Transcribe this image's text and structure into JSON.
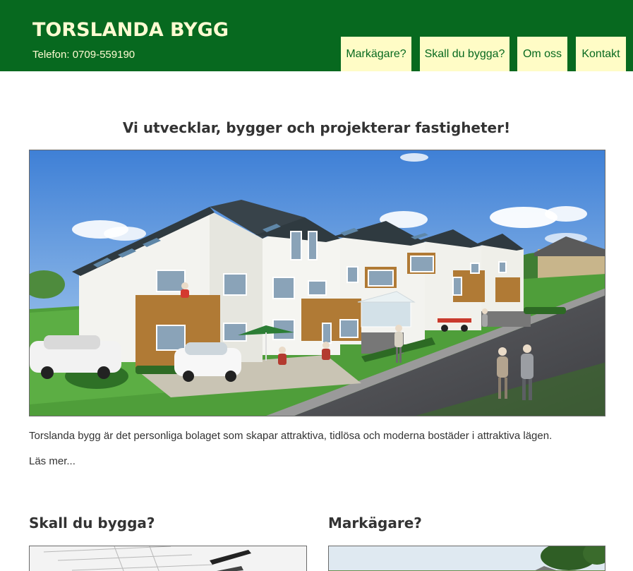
{
  "header": {
    "brand": "TORSLANDA BYGG",
    "phone": "Telefon: 0709-559190",
    "colors": {
      "background": "#07691f",
      "brand_text": "#fffbd2",
      "nav_background": "#fffcc6",
      "nav_text": "#07691f"
    }
  },
  "nav": {
    "items": [
      {
        "label": "Markägare?"
      },
      {
        "label": "Skall du bygga?"
      },
      {
        "label": "Om oss"
      },
      {
        "label": "Kontakt"
      }
    ]
  },
  "main": {
    "heading": "Vi utvecklar, bygger och projekterar fastigheter!",
    "intro": "Torslanda bygg är det personliga bolaget som skapar attraktiva, tidlösa och moderna bostäder i attraktiva lägen.",
    "read_more": "Läs mer..."
  },
  "sections": [
    {
      "title": "Skall du bygga?"
    },
    {
      "title": "Markägare?"
    }
  ]
}
